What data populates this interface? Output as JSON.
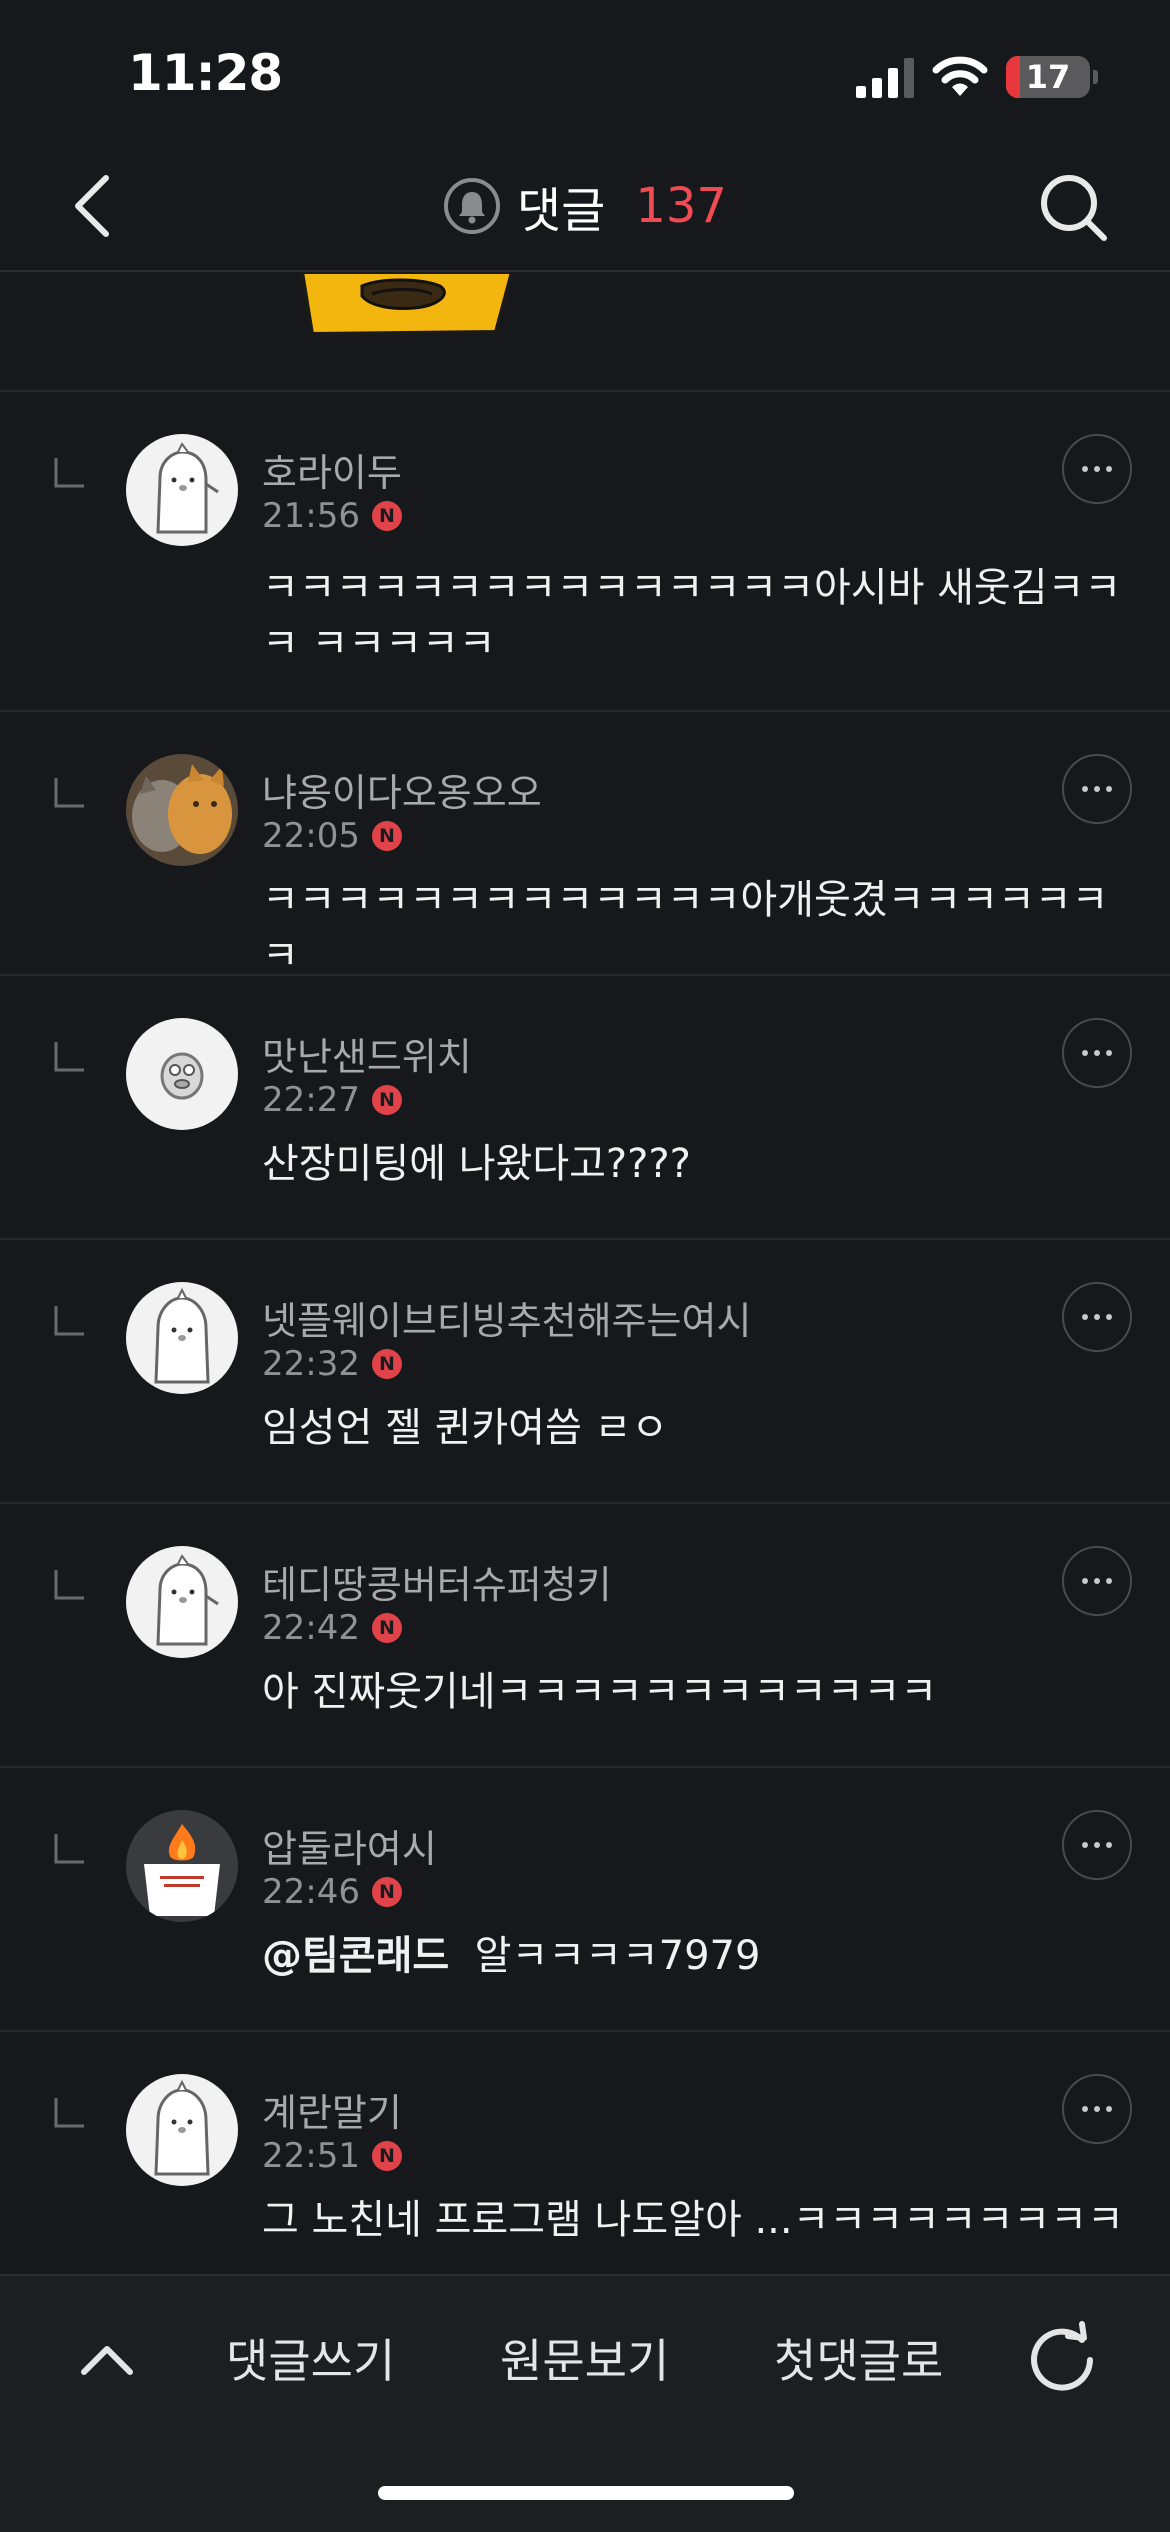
{
  "status_bar": {
    "time": "11:28",
    "battery": "17",
    "battery_level": 0.17,
    "signal_icon": "cellular-signal-icon",
    "wifi_icon": "wifi-icon"
  },
  "header": {
    "title": "댓글",
    "count": "137",
    "back_icon": "back-arrow-icon",
    "bell_icon": "notification-bell-icon",
    "search_icon": "search-icon"
  },
  "colors": {
    "background": "#17181b",
    "accent_red": "#ef4b52",
    "badge_red": "#e0444a",
    "divider": "#26272a"
  },
  "comments": [
    {
      "author": "호라이두",
      "time": "21:56",
      "badge": "N",
      "text": "ㅋㅋㅋㅋㅋㅋㅋㅋㅋㅋㅋㅋㅋㅋㅋ아시바 새웃김ㅋㅋㅋ ㅋㅋㅋㅋㅋ",
      "avatar": "cartoon-character-avatar"
    },
    {
      "author": "냐옹이다오옹오오",
      "time": "22:05",
      "badge": "N",
      "text": "ㅋㅋㅋㅋㅋㅋㅋㅋㅋㅋㅋㅋㅋ아개웃겼ㅋㅋㅋㅋㅋㅋㅋ",
      "avatar": "cat-photo-avatar"
    },
    {
      "author": "맛난샌드위치",
      "time": "22:27",
      "badge": "N",
      "text": "산장미팅에 나왔다고????",
      "avatar": "sandwich-character-avatar"
    },
    {
      "author": "넷플웨이브티빙추천해주는여시",
      "time": "22:32",
      "badge": "N",
      "text": "임성언 젤 퀸카여씀 ㄹㅇ",
      "avatar": "cartoon-character-avatar"
    },
    {
      "author": "테디땅콩버터슈퍼청키",
      "time": "22:42",
      "badge": "N",
      "text": "아 진짜웃기네ㅋㅋㅋㅋㅋㅋㅋㅋㅋㅋㅋㅋ",
      "avatar": "cartoon-character-avatar"
    },
    {
      "author": "압둘라여시",
      "time": "22:46",
      "badge": "N",
      "mention": "@팀콘래드",
      "text": "알ㅋㅋㅋㅋ7979",
      "avatar": "fire-cup-avatar"
    },
    {
      "author": "계란말기",
      "time": "22:51",
      "badge": "N",
      "text": "그 노친네 프로그램 나도알아 ...ㅋㅋㅋㅋㅋㅋㅋㅋㅋ",
      "avatar": "cartoon-character-avatar"
    }
  ],
  "toolbar": {
    "up_icon": "chevron-up-icon",
    "write_comment": "댓글쓰기",
    "view_original": "원문보기",
    "first_comment": "첫댓글로",
    "refresh_icon": "refresh-icon"
  }
}
